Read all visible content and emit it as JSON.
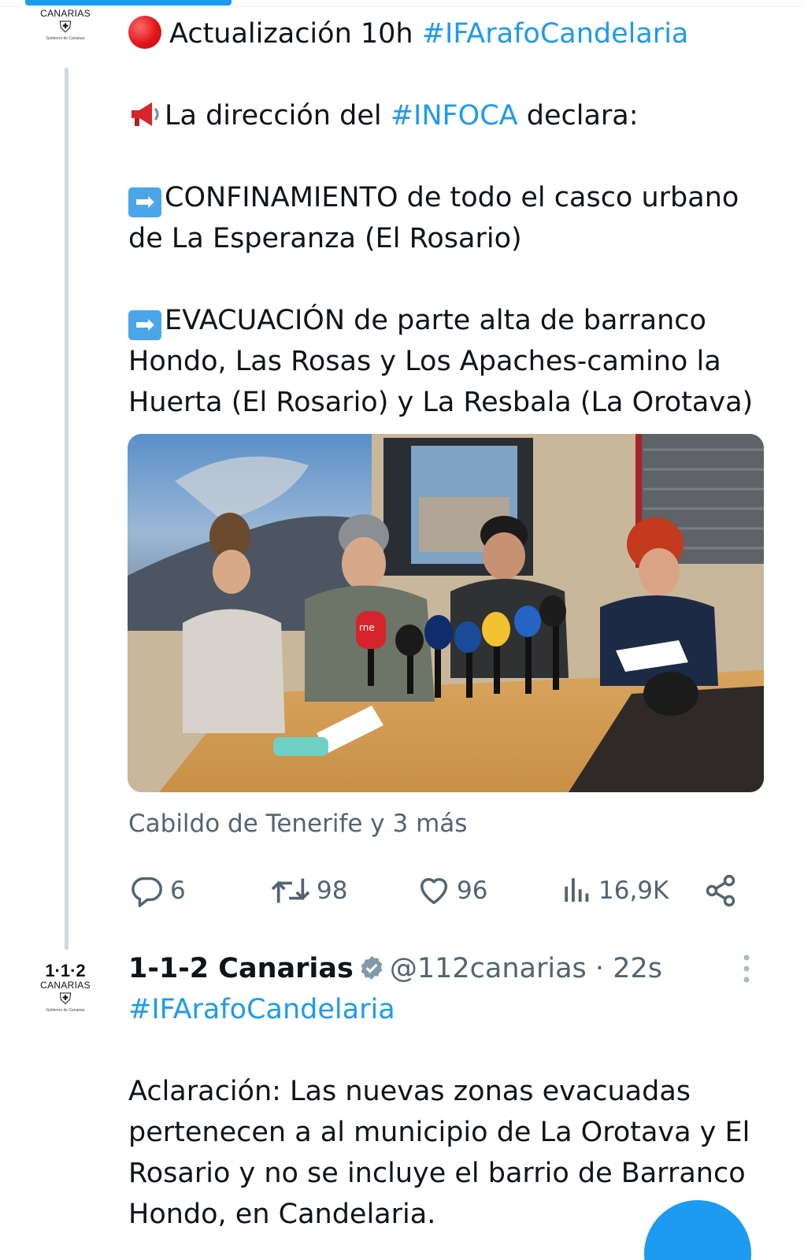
{
  "tweet1": {
    "avatar": {
      "org": "CANARIAS",
      "small": "Gobierno de Canarias"
    },
    "line1_text": "Actualización 10h ",
    "line1_tag": "#IFArafoCandelaria",
    "line2_pre": "La dirección del ",
    "line2_tag": "#INFOCA",
    "line2_post": " declara:",
    "para1_l1": "CONFINAMIENTO de todo el casco urbano",
    "para1_l2": "de La Esperanza (El Rosario)",
    "para2_l1": "EVACUACIÓN de parte alta de barranco",
    "para2_l2": "Hondo, Las Rosas y Los Apaches-camino la",
    "para2_l3": "Huerta (El Rosario) y La Resbala (La Orotava)",
    "arrow": "➡",
    "photo_mic_label": "rne",
    "caption": "Cabildo de Tenerife y 3 más",
    "replies": "6",
    "retweets": "98",
    "likes": "96",
    "views": "16,9K"
  },
  "tweet2": {
    "avatar": {
      "num": "1·1·2",
      "org": "CANARIAS",
      "small": "Gobierno de Canarias"
    },
    "name": "1-1-2 Canarias",
    "handle": "@112canarias",
    "separator": "·",
    "time": "22s",
    "tag": "#IFArafoCandelaria",
    "body_l1": "Aclaración: Las nuevas zonas evacuadas",
    "body_l2": "pertenecen a al municipio de La Orotava y El",
    "body_l3": "Rosario y no se incluye el barrio de Barranco",
    "body_l4": "Hondo, en Candelaria."
  },
  "icons": {
    "reply": "reply-icon",
    "retweet": "retweet-icon",
    "like": "heart-icon",
    "views": "views-icon",
    "share": "share-icon",
    "verified": "verified-badge-icon",
    "more": "more-options-icon",
    "compose": "compose-fab"
  },
  "colors": {
    "accent": "#1d9bf0",
    "text": "#0f1419",
    "muted": "#536471",
    "verified": "#829aab"
  }
}
